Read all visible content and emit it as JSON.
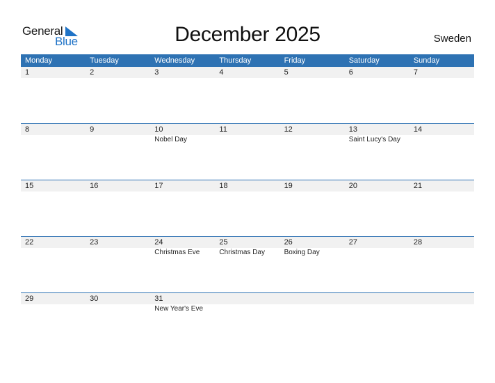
{
  "logo": {
    "line1": "General",
    "line2": "Blue"
  },
  "title": "December 2025",
  "country": "Sweden",
  "colors": {
    "accent": "#2e72b3",
    "date_strip": "#f1f1f1",
    "logo_blue": "#1f73c7"
  },
  "weekdays": [
    "Monday",
    "Tuesday",
    "Wednesday",
    "Thursday",
    "Friday",
    "Saturday",
    "Sunday"
  ],
  "weeks": [
    {
      "days": [
        {
          "num": "1",
          "holiday": ""
        },
        {
          "num": "2",
          "holiday": ""
        },
        {
          "num": "3",
          "holiday": ""
        },
        {
          "num": "4",
          "holiday": ""
        },
        {
          "num": "5",
          "holiday": ""
        },
        {
          "num": "6",
          "holiday": ""
        },
        {
          "num": "7",
          "holiday": ""
        }
      ]
    },
    {
      "days": [
        {
          "num": "8",
          "holiday": ""
        },
        {
          "num": "9",
          "holiday": ""
        },
        {
          "num": "10",
          "holiday": "Nobel Day"
        },
        {
          "num": "11",
          "holiday": ""
        },
        {
          "num": "12",
          "holiday": ""
        },
        {
          "num": "13",
          "holiday": "Saint Lucy's Day"
        },
        {
          "num": "14",
          "holiday": ""
        }
      ]
    },
    {
      "days": [
        {
          "num": "15",
          "holiday": ""
        },
        {
          "num": "16",
          "holiday": ""
        },
        {
          "num": "17",
          "holiday": ""
        },
        {
          "num": "18",
          "holiday": ""
        },
        {
          "num": "19",
          "holiday": ""
        },
        {
          "num": "20",
          "holiday": ""
        },
        {
          "num": "21",
          "holiday": ""
        }
      ]
    },
    {
      "days": [
        {
          "num": "22",
          "holiday": ""
        },
        {
          "num": "23",
          "holiday": ""
        },
        {
          "num": "24",
          "holiday": "Christmas Eve"
        },
        {
          "num": "25",
          "holiday": "Christmas Day"
        },
        {
          "num": "26",
          "holiday": "Boxing Day"
        },
        {
          "num": "27",
          "holiday": ""
        },
        {
          "num": "28",
          "holiday": ""
        }
      ]
    },
    {
      "days": [
        {
          "num": "29",
          "holiday": ""
        },
        {
          "num": "30",
          "holiday": ""
        },
        {
          "num": "31",
          "holiday": "New Year's Eve"
        },
        {
          "num": "",
          "holiday": ""
        },
        {
          "num": "",
          "holiday": ""
        },
        {
          "num": "",
          "holiday": ""
        },
        {
          "num": "",
          "holiday": ""
        }
      ]
    }
  ]
}
